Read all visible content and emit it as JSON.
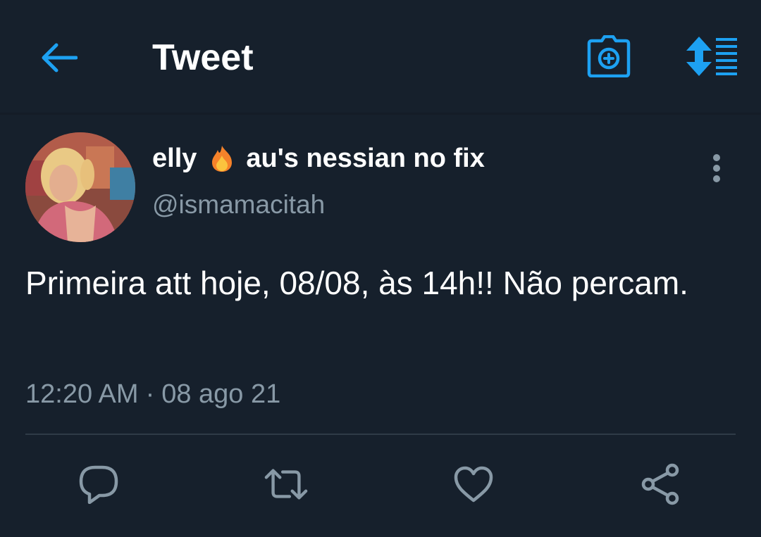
{
  "header": {
    "title": "Tweet",
    "back_icon": "arrow-left-icon",
    "camera_icon": "camera-plus-icon",
    "sort_icon": "sort-lines-icon",
    "accent_color": "#1da1f2"
  },
  "tweet": {
    "display_name_part1": "elly",
    "display_name_emoji": "fire-emoji",
    "display_name_part2": "au's nessian no fix",
    "handle": "@ismamacitah",
    "text": "Primeira att hoje, 08/08, às 14h!! Não percam.",
    "time": "12:20 AM",
    "separator": "·",
    "date": "08 ago 21"
  },
  "actions": {
    "reply_icon": "reply-icon",
    "retweet_icon": "retweet-icon",
    "like_icon": "heart-icon",
    "share_icon": "share-icon",
    "icon_color": "#8899a6"
  },
  "colors": {
    "background": "#16202c",
    "text_primary": "#ffffff",
    "text_secondary": "#8899a6"
  }
}
